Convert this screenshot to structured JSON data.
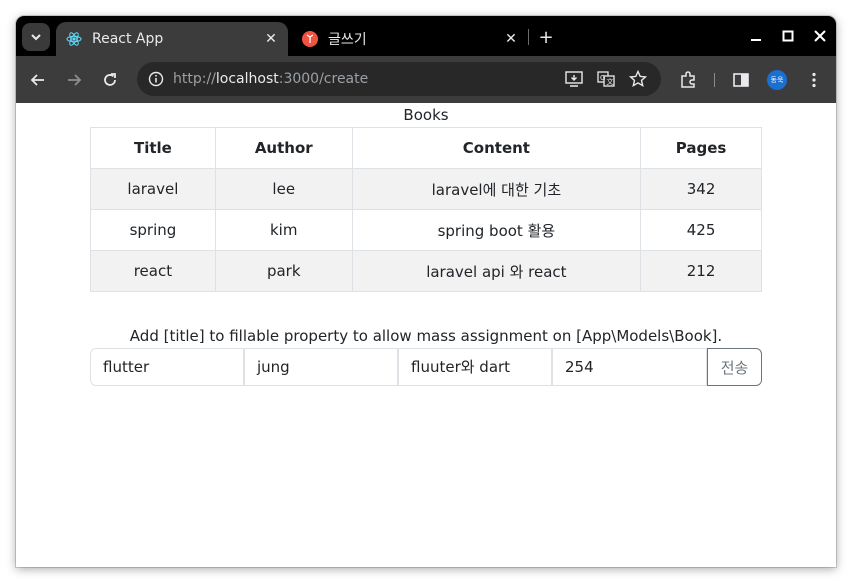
{
  "browser": {
    "tabs": [
      {
        "title": "React App",
        "active": true,
        "icon": "react-icon"
      },
      {
        "title": "글쓰기",
        "active": false,
        "icon": "laravel-icon"
      }
    ],
    "url": {
      "scheme": "http://",
      "host": "localhost",
      "rest": ":3000/create"
    },
    "profile_label": "동욱"
  },
  "page": {
    "caption": "Books",
    "table": {
      "headers": [
        "Title",
        "Author",
        "Content",
        "Pages"
      ],
      "rows": [
        [
          "laravel",
          "lee",
          "laravel에 대한 기초",
          "342"
        ],
        [
          "spring",
          "kim",
          "spring boot 활용",
          "425"
        ],
        [
          "react",
          "park",
          "laravel api 와 react",
          "212"
        ]
      ]
    },
    "error_message": "Add [title] to fillable property to allow mass assignment on [App\\Models\\Book].",
    "form": {
      "title": "flutter",
      "author": "jung",
      "content": "fluuter와 dart",
      "pages": "254",
      "submit_label": "전송"
    }
  },
  "colors": {
    "tabstrip": "#000000",
    "toolbar": "#3c3c3c",
    "omnibox": "#282828",
    "row_stripe": "#f2f2f2",
    "border": "#dee2e6",
    "submit_border": "#6c757d",
    "profile": "#1a6fd1"
  }
}
